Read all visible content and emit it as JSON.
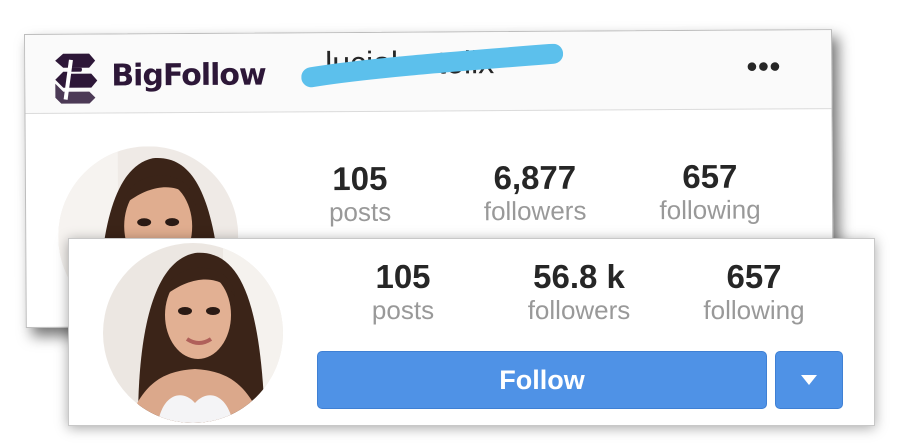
{
  "colors": {
    "brand": "#2d1738",
    "follow_button": "#4f92e6",
    "scribble": "#5cc0ec",
    "stat_label": "#999999"
  },
  "back_card": {
    "logo": {
      "icon": "bigfollow-logo-icon",
      "brand": "BigFollow"
    },
    "username": "luciabartolix",
    "more_icon": "more-options-icon",
    "more_label": "•••",
    "stats": {
      "posts": {
        "value": "105",
        "label": "posts"
      },
      "followers": {
        "value": "6,877",
        "label": "followers"
      },
      "following": {
        "value": "657",
        "label": "following"
      }
    }
  },
  "front_card": {
    "stats": {
      "posts": {
        "value": "105",
        "label": "posts"
      },
      "followers": {
        "value": "56.8 k",
        "label": "followers"
      },
      "following": {
        "value": "657",
        "label": "following"
      }
    },
    "follow_button": "Follow",
    "dropdown_icon": "caret-down-icon"
  }
}
